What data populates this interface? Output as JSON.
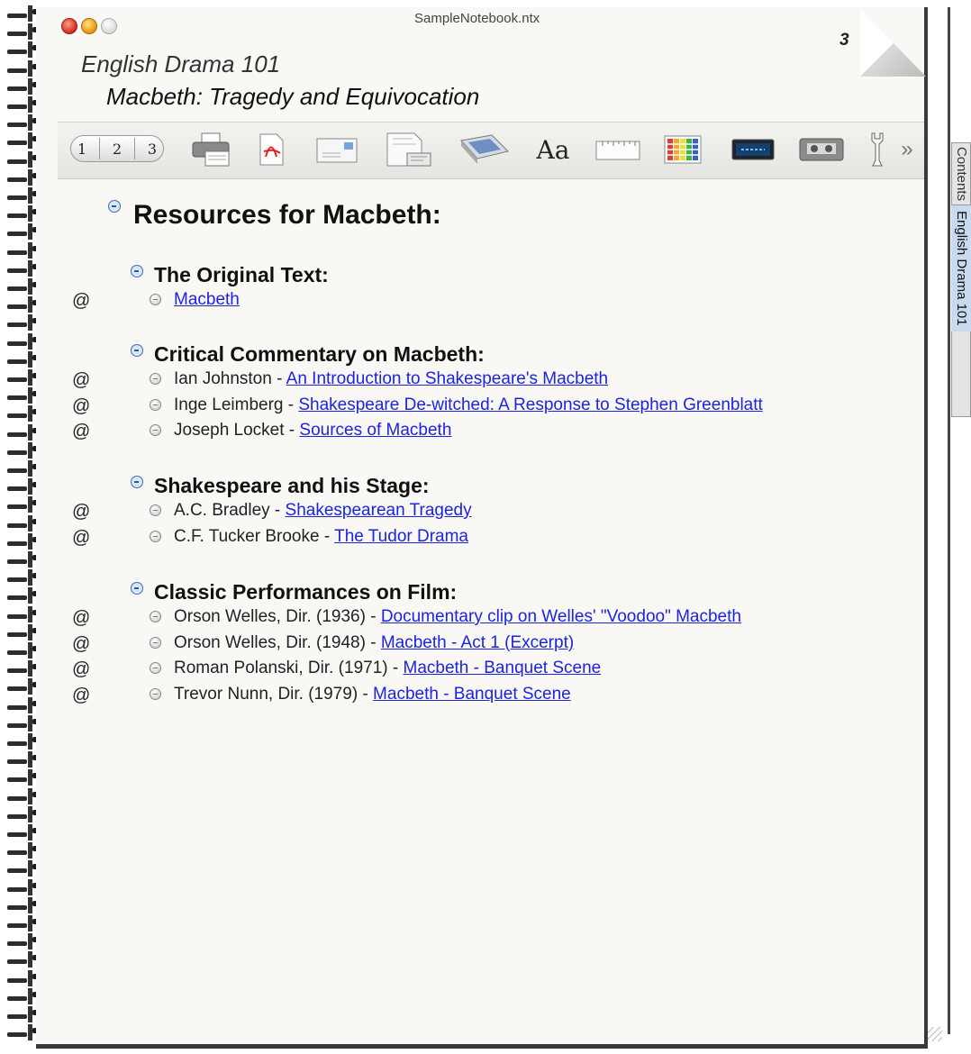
{
  "window": {
    "title": "SampleNotebook.ntx",
    "page_number": "3",
    "notebook_title": "English Drama 101",
    "page_title": "Macbeth: Tragedy and Equivocation"
  },
  "toolbar": {
    "page_numbers": [
      "1",
      "2",
      "3"
    ],
    "font_label": "Aa",
    "more_label": "»",
    "icons": [
      "print-icon",
      "pdf-icon",
      "mail-icon",
      "attach-icon",
      "picture-icon",
      "font-icon",
      "ruler-icon",
      "color-grid-icon",
      "clock-icon",
      "tape-icon",
      "wrench-icon"
    ]
  },
  "outline": {
    "title": "Resources for Macbeth:",
    "sections": [
      {
        "heading": "The Original Text:",
        "items": [
          {
            "prefix": "",
            "link": "Macbeth"
          }
        ]
      },
      {
        "heading": "Critical Commentary on Macbeth:",
        "items": [
          {
            "prefix": "Ian Johnston - ",
            "link": "An Introduction to Shakespeare's Macbeth"
          },
          {
            "prefix": "Inge Leimberg - ",
            "link": "Shakespeare De-witched: A Response to Stephen Greenblatt"
          },
          {
            "prefix": "Joseph Locket - ",
            "link": "Sources of Macbeth"
          }
        ]
      },
      {
        "heading": "Shakespeare and his Stage:",
        "items": [
          {
            "prefix": "A.C. Bradley - ",
            "link": "Shakespearean Tragedy"
          },
          {
            "prefix": "C.F. Tucker Brooke - ",
            "link": "The Tudor Drama"
          }
        ]
      },
      {
        "heading": "Classic Performances on Film:",
        "items": [
          {
            "prefix": "Orson Welles, Dir. (1936) - ",
            "link": "Documentary clip on Welles' \"Voodoo\" Macbeth"
          },
          {
            "prefix": "Orson Welles, Dir. (1948) - ",
            "link": "Macbeth - Act 1 (Excerpt)"
          },
          {
            "prefix": "Roman Polanski, Dir. (1971) - ",
            "link": "Macbeth - Banquet Scene"
          },
          {
            "prefix": "Trevor Nunn, Dir. (1979) - ",
            "link": "Macbeth - Banquet Scene"
          }
        ]
      }
    ],
    "link_marker": "@"
  },
  "side_tabs": {
    "contents": "Contents",
    "active": "English Drama 101"
  },
  "colors": {
    "link": "#1c24e0",
    "page": "#f9f8f4",
    "collapse": "#3c6cb8"
  }
}
